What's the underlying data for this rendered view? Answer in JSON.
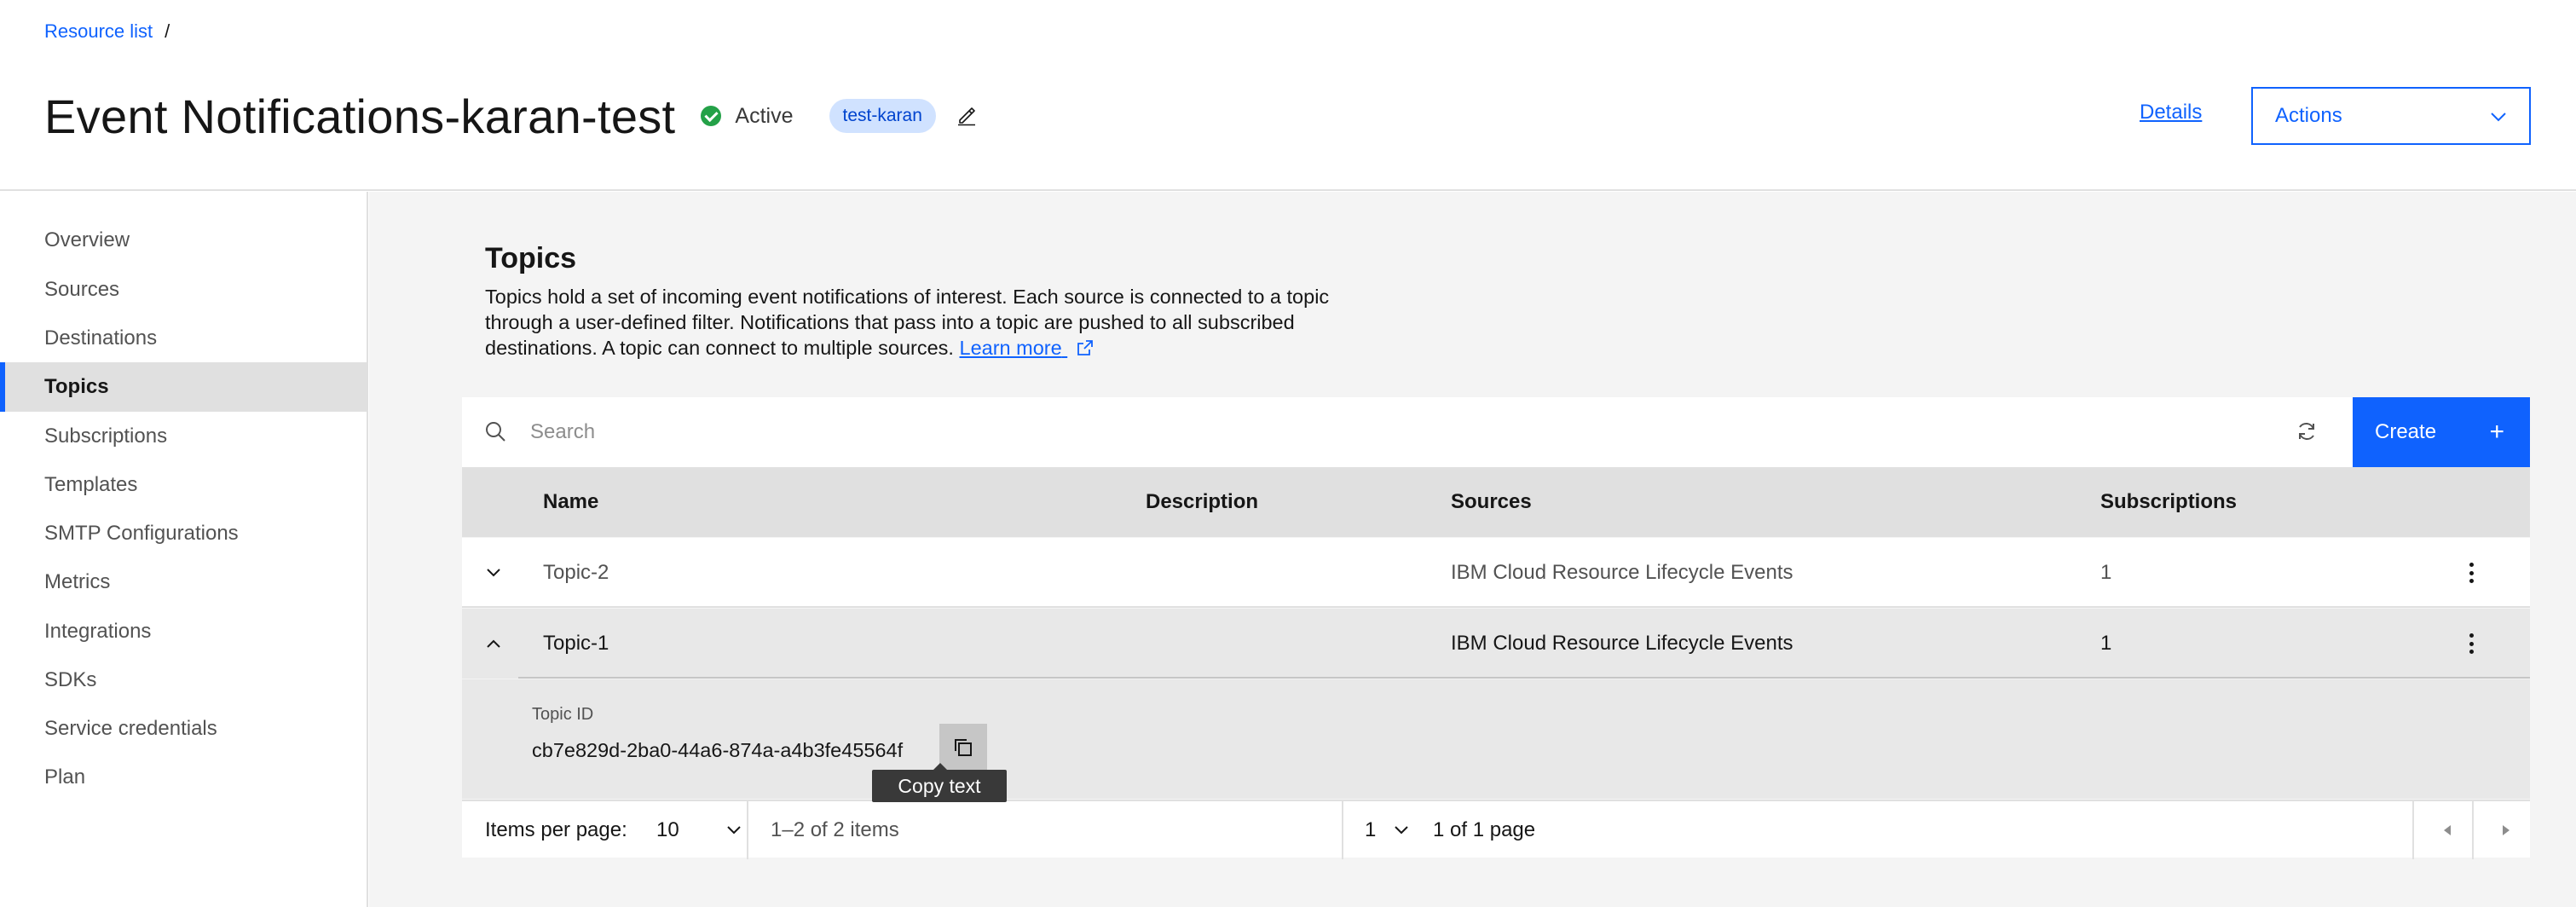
{
  "breadcrumb": {
    "link": "Resource list",
    "separator": "/"
  },
  "header": {
    "title": "Event Notifications-karan-test",
    "status": "Active",
    "tag": "test-karan",
    "details_label": "Details",
    "actions_label": "Actions"
  },
  "sidebar": {
    "items": [
      {
        "label": "Overview"
      },
      {
        "label": "Sources"
      },
      {
        "label": "Destinations"
      },
      {
        "label": "Topics"
      },
      {
        "label": "Subscriptions"
      },
      {
        "label": "Templates"
      },
      {
        "label": "SMTP Configurations"
      },
      {
        "label": "Metrics"
      },
      {
        "label": "Integrations"
      },
      {
        "label": "SDKs"
      },
      {
        "label": "Service credentials"
      },
      {
        "label": "Plan"
      }
    ],
    "active": "Topics"
  },
  "section": {
    "title": "Topics",
    "description": "Topics hold a set of incoming event notifications of interest. Each source is connected to a topic through a user-defined filter. Notifications that pass into a topic are pushed to all subscribed destinations. A topic can connect to multiple sources.",
    "learn_more": "Learn more"
  },
  "toolbar": {
    "search_placeholder": "Search",
    "create_label": "Create",
    "create_plus": "+"
  },
  "table": {
    "headers": {
      "name": "Name",
      "description": "Description",
      "sources": "Sources",
      "subscriptions": "Subscriptions"
    },
    "rows": [
      {
        "name": "Topic-2",
        "description": "",
        "sources": "IBM Cloud Resource Lifecycle Events",
        "subscriptions": "1",
        "expanded": false
      },
      {
        "name": "Topic-1",
        "description": "",
        "sources": "IBM Cloud Resource Lifecycle Events",
        "subscriptions": "1",
        "expanded": true
      }
    ],
    "expanded": {
      "label": "Topic ID",
      "value": "cb7e829d-2ba0-44a6-874a-a4b3fe45564f",
      "tooltip": "Copy text"
    }
  },
  "pagination": {
    "items_per_page_label": "Items per page:",
    "items_per_page_value": "10",
    "range": "1–2 of 2 items",
    "page_value": "1",
    "page_text": "1 of 1 page"
  },
  "colors": {
    "accent": "#0f62fe",
    "status_active": "#24a148",
    "tag_bg": "#d0e2ff",
    "tag_text": "#0043ce"
  }
}
